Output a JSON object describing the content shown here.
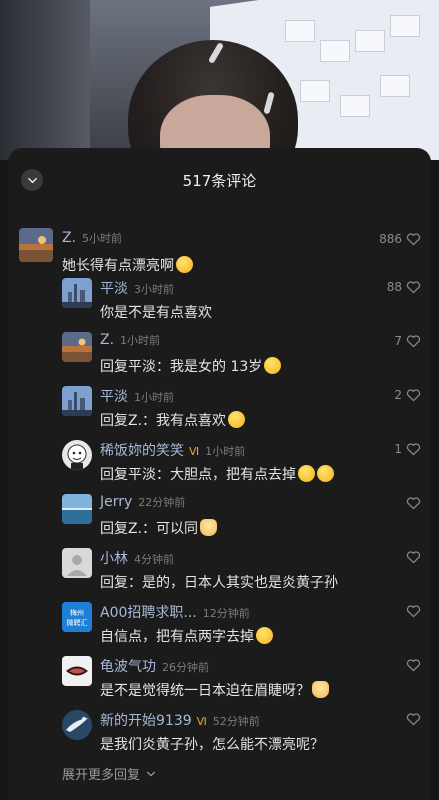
{
  "header": {
    "title": "517条评论"
  },
  "comments": [
    {
      "user": "Z.",
      "time": "5小时前",
      "text": "她长得有点漂亮啊",
      "emoji": "smile",
      "likes": "886",
      "replies": [
        {
          "user": "平淡",
          "time": "3小时前",
          "text": "你是不是有点喜欢",
          "likes": "88",
          "avatar": "city"
        },
        {
          "user": "Z.",
          "time": "1小时前",
          "text": "回复平淡：我是女的 13岁",
          "emoji": "laugh-cry",
          "likes": "7",
          "avatar": "sunset"
        },
        {
          "user": "平淡",
          "time": "1小时前",
          "text": "回复Z.：我有点喜欢",
          "emoji": "grin",
          "likes": "2",
          "avatar": "city"
        },
        {
          "user": "稀饭妳的笑笑",
          "time": "1小时前",
          "text": "回复平淡：大胆点，把有点去掉",
          "emoji": "grin-grin",
          "likes": "1",
          "avatar": "cartoon",
          "badge": "Ⅵ"
        },
        {
          "user": "Jerry",
          "time": "22分钟前",
          "text": "回复Z.：可以同",
          "emoji": "cat",
          "likes": "",
          "avatar": "sea"
        },
        {
          "user": "小林",
          "time": "4分钟前",
          "text": "回复：是的，日本人其实也是炎黄子孙",
          "likes": "",
          "avatar": "default"
        },
        {
          "user": "A00招聘求职...",
          "time": "12分钟前",
          "text": "自信点，把有点两字去掉",
          "emoji": "grin",
          "likes": "",
          "avatar": "recruit",
          "avatar_text": "梅州\n微聘汇"
        },
        {
          "user": "龟波气功",
          "time": "26分钟前",
          "text": "是不是觉得统一日本迫在眉睫呀？",
          "emoji": "dog",
          "likes": "",
          "avatar": "mouth"
        },
        {
          "user": "新的开始9139",
          "time": "52分钟前",
          "text": "是我们炎黄子孙，怎么能不漂亮呢？",
          "likes": "",
          "avatar": "bird",
          "badge": "Ⅵ"
        }
      ]
    }
  ],
  "footer": {
    "more_replies": "展开更多回复"
  },
  "icons": {
    "collapse": "chevron-down-icon",
    "like": "heart-icon",
    "expand": "chevron-down-icon"
  },
  "colors": {
    "username": "#a6b9d6",
    "badge": "#e2a93a",
    "background": "#1b1b1b"
  }
}
